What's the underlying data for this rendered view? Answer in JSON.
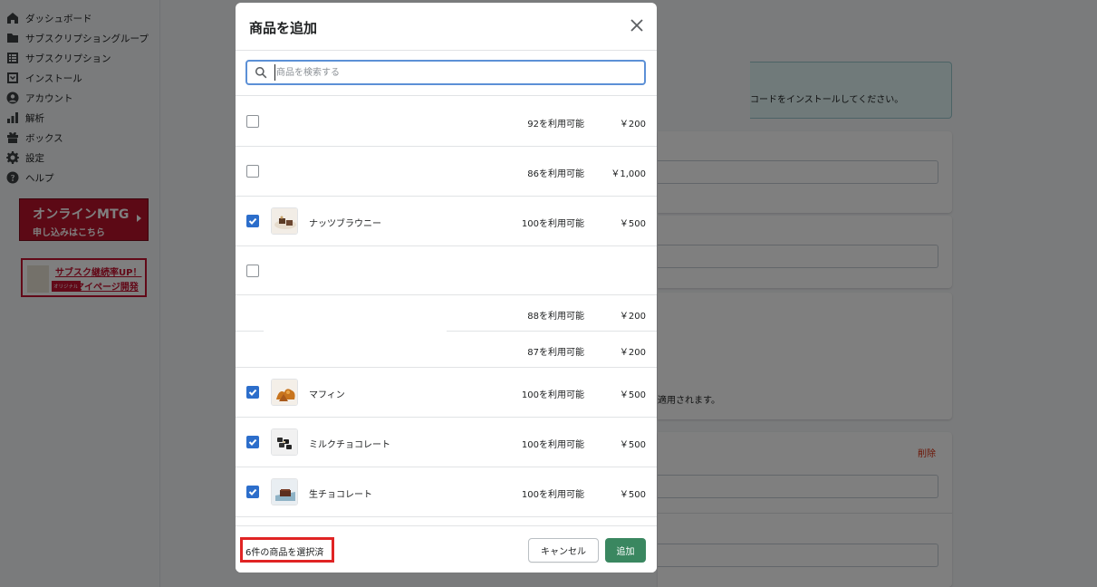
{
  "sidebar": {
    "items": [
      {
        "label": "ダッシュボード",
        "icon": "home-icon"
      },
      {
        "label": "サブスクリプショングループ",
        "icon": "folder-icon"
      },
      {
        "label": "サブスクリプション",
        "icon": "list-icon"
      },
      {
        "label": "インストール",
        "icon": "install-icon"
      },
      {
        "label": "アカウント",
        "icon": "account-icon"
      },
      {
        "label": "解析",
        "icon": "analytics-icon"
      },
      {
        "label": "ボックス",
        "icon": "gift-icon"
      },
      {
        "label": "設定",
        "icon": "gear-icon"
      },
      {
        "label": "ヘルプ",
        "icon": "help-icon"
      }
    ],
    "banner_mtg": {
      "title": "オンラインMTG",
      "subtitle": "申し込みはこちら"
    },
    "banner_mypage": {
      "line1": "サブスク継続率UP！",
      "tag": "オリジナル",
      "line2": "マイページ開発"
    }
  },
  "background": {
    "notice_text": "コードをインストールしてください。",
    "note_text": "適用されます。",
    "delete_label": "削除"
  },
  "modal": {
    "title": "商品を追加",
    "search_placeholder": "商品を検索する",
    "rows": [
      {
        "checked": false,
        "name": "",
        "availability": "92を利用可能",
        "price": "￥200"
      },
      {
        "checked": false,
        "name": "",
        "availability": "86を利用可能",
        "price": "￥1,000"
      },
      {
        "checked": true,
        "name": "ナッツブラウニー",
        "availability": "100を利用可能",
        "price": "￥500"
      },
      {
        "checked": false,
        "name": "",
        "availability": "",
        "price": ""
      },
      {
        "checked": false,
        "name": "",
        "availability": "88を利用可能",
        "price": "￥200"
      },
      {
        "checked": false,
        "name": "",
        "availability": "87を利用可能",
        "price": "￥200"
      },
      {
        "checked": true,
        "name": "マフィン",
        "availability": "100を利用可能",
        "price": "￥500"
      },
      {
        "checked": true,
        "name": "ミルクチョコレート",
        "availability": "100を利用可能",
        "price": "￥500"
      },
      {
        "checked": true,
        "name": "生チョコレート",
        "availability": "100を利用可能",
        "price": "￥500"
      }
    ],
    "footer": {
      "selected_count": "6件の商品を選択済",
      "cancel_label": "キャンセル",
      "add_label": "追加"
    }
  },
  "colors": {
    "primary": "#3a8760",
    "checkbox": "#2c6ecb",
    "highlight": "#e02424",
    "banner": "#b9122a"
  }
}
